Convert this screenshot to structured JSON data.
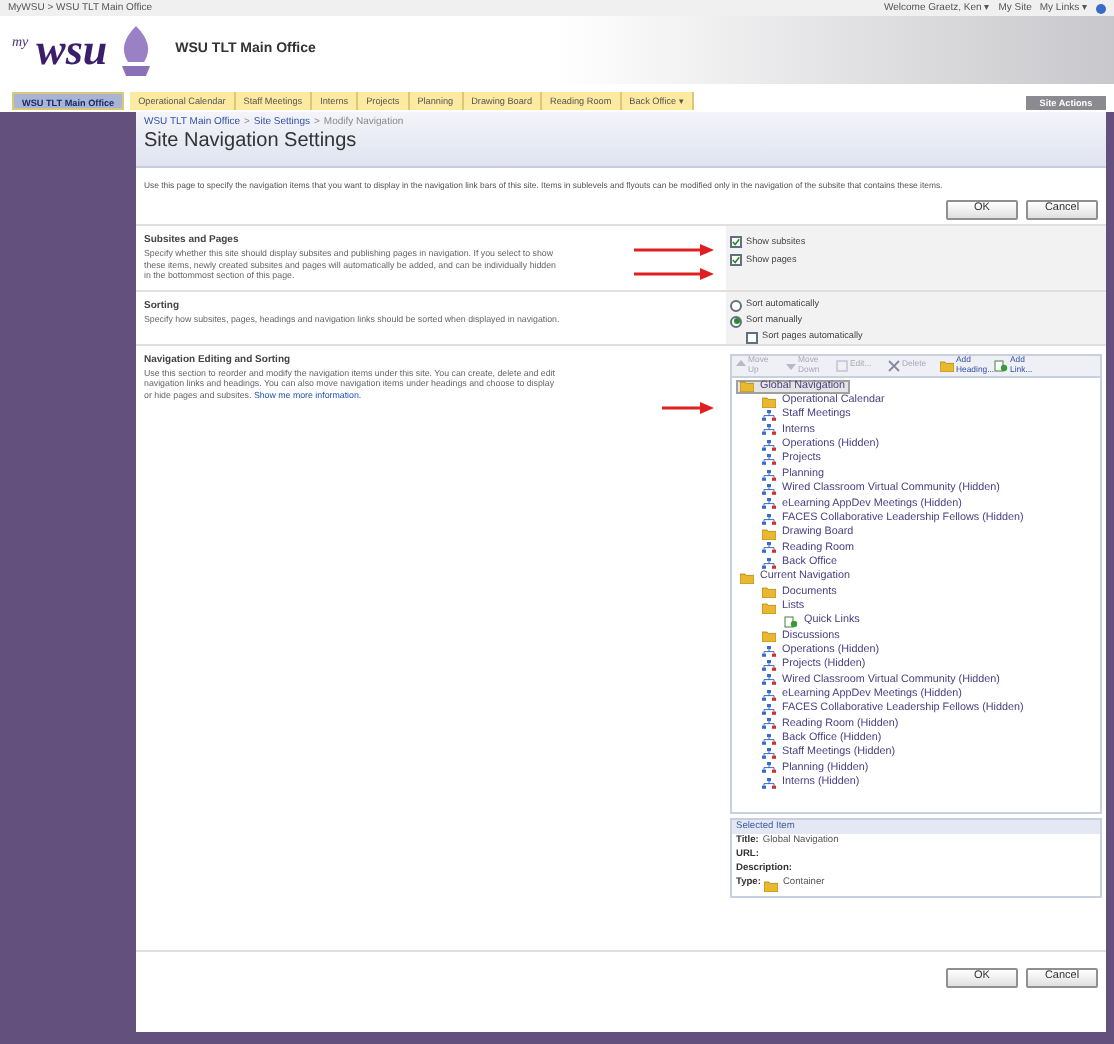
{
  "top_bar": {
    "breadcrumb": "MyWSU > WSU TLT Main Office",
    "welcome": "Welcome Graetz, Ken",
    "welcome_caret": "▾",
    "my_site": "My Site",
    "my_links": "My Links",
    "my_links_caret": "▾"
  },
  "header": {
    "logo_small": "my",
    "logo": "wsu",
    "site_title": "WSU TLT Main Office"
  },
  "tabs": [
    {
      "label": "WSU TLT Main Office",
      "selected": true
    },
    {
      "label": "Operational Calendar",
      "selected": false
    },
    {
      "label": "Staff Meetings",
      "selected": false
    },
    {
      "label": "Interns",
      "selected": false
    },
    {
      "label": "Projects",
      "selected": false
    },
    {
      "label": "Planning",
      "selected": false
    },
    {
      "label": "Drawing Board",
      "selected": false
    },
    {
      "label": "Reading Room",
      "selected": false
    },
    {
      "label": "Back Office",
      "selected": false,
      "caret": "▾"
    }
  ],
  "site_actions": "Site Actions",
  "page": {
    "breadcrumb": [
      {
        "label": "WSU TLT Main Office",
        "kind": "link"
      },
      {
        "label": ">",
        "kind": "separator"
      },
      {
        "label": "Site Settings",
        "kind": "link"
      },
      {
        "label": ">",
        "kind": "separator"
      },
      {
        "label": "Modify Navigation",
        "kind": "current"
      }
    ],
    "title": "Site Navigation Settings",
    "description": "Use this page to specify the navigation items that you want to display in the navigation link bars of this site. Items in sublevels and flyouts can be modified only in the navigation of the subsite that contains these items.",
    "top_buttons": [
      "OK",
      "Cancel"
    ]
  },
  "sections": [
    {
      "kind": "checks",
      "title": "Subsites and Pages",
      "description": "Specify whether this site should display subsites and publishing pages in navigation. If you select to show these items, newly created subsites and pages will automatically be added, and can be individually hidden in the bottommost section of this page.",
      "options": [
        {
          "label": "Show subsites",
          "checked": true,
          "arrow": true
        },
        {
          "label": "Show pages",
          "checked": true,
          "arrow": true
        }
      ]
    },
    {
      "kind": "sorting",
      "title": "Sorting",
      "description": "Specify how subsites, pages, headings and navigation links should be sorted when displayed in navigation.",
      "radios": [
        {
          "label": "Sort automatically",
          "selected": false
        },
        {
          "label": "Sort manually",
          "selected": true
        }
      ],
      "sub_option": {
        "label": "Sort pages automatically",
        "checked": false
      }
    },
    {
      "kind": "tree",
      "title": "Navigation Editing and Sorting",
      "description": "Use this section to reorder and modify the navigation items under this site. You can create, delete and edit navigation links and headings. You can also move navigation items under headings and choose to display or hide pages and subsites.",
      "link": "Show me more information.",
      "arrow": true
    }
  ],
  "toolbar": [
    {
      "label": "Move Up",
      "kind": "up",
      "disabled": true
    },
    {
      "label": "Move Down",
      "kind": "down",
      "disabled": true
    },
    {
      "label": "Edit...",
      "kind": "edit",
      "disabled": true
    },
    {
      "label": "Delete",
      "kind": "delete",
      "disabled": true
    },
    {
      "label": "Add Heading...",
      "kind": "heading",
      "disabled": false
    },
    {
      "label": "Add Link...",
      "kind": "link",
      "disabled": false
    }
  ],
  "tree": [
    {
      "label": "Global Navigation",
      "kind": "folder",
      "selected": true,
      "children": [
        {
          "label": "Operational Calendar",
          "kind": "folder",
          "selected": false
        },
        {
          "label": "Staff Meetings",
          "kind": "site",
          "selected": false
        },
        {
          "label": "Interns",
          "kind": "site",
          "selected": false
        },
        {
          "label": "Operations (Hidden)",
          "kind": "site",
          "selected": false
        },
        {
          "label": "Projects",
          "kind": "site",
          "selected": false
        },
        {
          "label": "Planning",
          "kind": "site",
          "selected": false
        },
        {
          "label": "Wired Classroom Virtual Community (Hidden)",
          "kind": "site",
          "selected": false
        },
        {
          "label": "eLearning AppDev Meetings (Hidden)",
          "kind": "site",
          "selected": false
        },
        {
          "label": "FACES Collaborative Leadership Fellows (Hidden)",
          "kind": "site",
          "selected": false
        },
        {
          "label": "Drawing Board",
          "kind": "folder",
          "selected": false
        },
        {
          "label": "Reading Room",
          "kind": "site",
          "selected": false
        },
        {
          "label": "Back Office",
          "kind": "site",
          "selected": false
        }
      ]
    },
    {
      "label": "Current Navigation",
      "kind": "folder",
      "selected": false,
      "children": [
        {
          "label": "Documents",
          "kind": "folder",
          "selected": false
        },
        {
          "label": "Lists",
          "kind": "folder",
          "selected": false,
          "children": [
            {
              "label": "Quick Links",
              "kind": "link",
              "selected": false
            }
          ]
        },
        {
          "label": "Discussions",
          "kind": "folder",
          "selected": false
        },
        {
          "label": "Operations (Hidden)",
          "kind": "site",
          "selected": false
        },
        {
          "label": "Projects (Hidden)",
          "kind": "site",
          "selected": false
        },
        {
          "label": "Wired Classroom Virtual Community (Hidden)",
          "kind": "site",
          "selected": false
        },
        {
          "label": "eLearning AppDev Meetings (Hidden)",
          "kind": "site",
          "selected": false
        },
        {
          "label": "FACES Collaborative Leadership Fellows (Hidden)",
          "kind": "site",
          "selected": false
        },
        {
          "label": "Reading Room (Hidden)",
          "kind": "site",
          "selected": false
        },
        {
          "label": "Back Office (Hidden)",
          "kind": "site",
          "selected": false
        },
        {
          "label": "Staff Meetings (Hidden)",
          "kind": "site",
          "selected": false
        },
        {
          "label": "Planning (Hidden)",
          "kind": "site",
          "selected": false
        },
        {
          "label": "Interns (Hidden)",
          "kind": "site",
          "selected": false
        }
      ]
    }
  ],
  "selected_item": {
    "heading": "Selected Item",
    "fields": [
      {
        "label": "Title:",
        "value": "Global Navigation"
      },
      {
        "label": "URL:"
      },
      {
        "label": "Description:"
      },
      {
        "label": "Type:",
        "value": "Container",
        "kind": "folder"
      }
    ]
  },
  "bottom_buttons": [
    "OK",
    "Cancel"
  ]
}
